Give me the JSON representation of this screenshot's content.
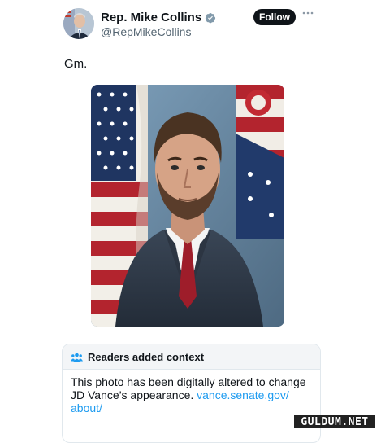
{
  "tweet": {
    "author_name": "Rep. Mike Collins",
    "handle": "@RepMikeCollins",
    "follow_label": "Follow",
    "text": "Gm.",
    "verified_icon": "verified-badge-icon",
    "more_icon": "more-options-icon"
  },
  "community_note": {
    "title": "Readers added context",
    "icon": "people-icon",
    "body": "This photo has been digitally altered to change JD Vance’s appearance. ",
    "link_text": "vance.senate.gov/\nabout/"
  },
  "watermark": {
    "text": "GULDUM.NET"
  },
  "colors": {
    "accent": "#1d9bf0",
    "follow_button": "#0f1419",
    "secondary_text": "#536471",
    "verified_badge": "#829aab"
  }
}
